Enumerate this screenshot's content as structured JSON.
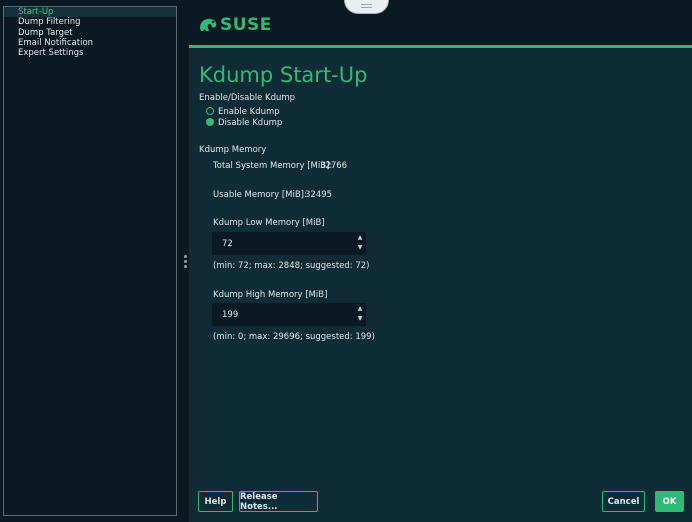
{
  "sidebar": {
    "items": [
      {
        "label": "Start-Up",
        "active": true
      },
      {
        "label": "Dump Filtering",
        "active": false
      },
      {
        "label": "Dump Target",
        "active": false
      },
      {
        "label": "Email Notification",
        "active": false
      },
      {
        "label": "Expert Settings",
        "active": false
      }
    ]
  },
  "header": {
    "logo_text": "SUSE"
  },
  "main": {
    "title": "Kdump Start-Up",
    "enable_group_label": "Enable/Disable Kdump",
    "enable_label": "Enable Kdump",
    "disable_label": "Disable Kdump",
    "selected": "disable",
    "memory_section_label": "Kdump Memory",
    "total_memory_label": "Total System Memory [MiB]:",
    "total_memory_value": "32766",
    "usable_memory_label": "Usable Memory [MiB]:",
    "usable_memory_value": "32495",
    "low_memory_label": "Kdump Low Memory [MiB]",
    "low_memory_value": "72",
    "low_memory_hint": "(min: 72; max: 2848; suggested: 72)",
    "high_memory_label": "Kdump High Memory [MiB]",
    "high_memory_value": "199",
    "high_memory_hint": "(min: 0; max: 29696; suggested: 199)"
  },
  "buttons": {
    "help": "Help",
    "release_notes": "Release Notes...",
    "cancel": "Cancel",
    "ok": "OK"
  },
  "colors": {
    "accent": "#30ba78",
    "background": "#0e2b36",
    "sidebar": "#0b1a22"
  },
  "icons": {
    "spin_up": "▲",
    "spin_down": "▼"
  }
}
